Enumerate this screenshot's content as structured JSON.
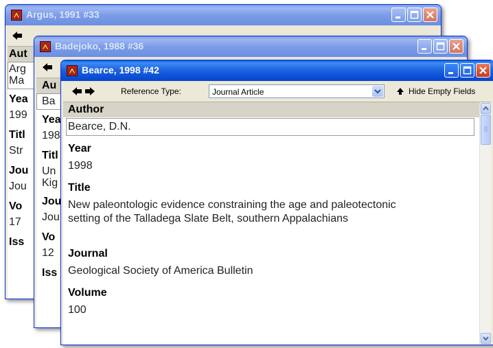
{
  "icons": {
    "app": "endnote-app-icon",
    "minimize": "minimize-icon",
    "maximize": "maximize-icon",
    "close": "close-icon",
    "back": "back-arrow-icon",
    "forward": "forward-arrow-icon",
    "collapse": "collapse-up-icon",
    "dropdown": "chevron-down-icon"
  },
  "colors": {
    "titlebar_active": "#0a5fe0",
    "titlebar_inactive": "#7c9ce8",
    "close": "#c53b1b",
    "selected_field": "#d6d3c7"
  },
  "window1": {
    "title": "Argus, 1991 #33",
    "fields": [
      {
        "label": "Aut",
        "value_lines": [
          "Arg",
          "Ma"
        ]
      },
      {
        "label": "Yea",
        "value": "199"
      },
      {
        "label": "Titl",
        "value": "Str"
      },
      {
        "label": "Jou",
        "value": "Jou"
      },
      {
        "label": "Vo",
        "value": "17"
      },
      {
        "label": "Iss"
      }
    ]
  },
  "window2": {
    "title": "Badejoko, 1988 #36",
    "fields": [
      {
        "label": "Au",
        "value": "Ba"
      },
      {
        "label": "Yea",
        "value": "198"
      },
      {
        "label": "Titl",
        "value_lines": [
          "Un",
          "Kig"
        ]
      },
      {
        "label": "Jou",
        "value": "Jou"
      },
      {
        "label": "Vo",
        "value": "12"
      },
      {
        "label": "Iss"
      }
    ]
  },
  "window3": {
    "title": "Bearce, 1998 #42",
    "toolbar": {
      "reference_type_label": "Reference Type:",
      "reference_type_value": "Journal Article",
      "hide_empty_label": "Hide Empty Fields"
    },
    "fields": {
      "author": {
        "label": "Author",
        "value": "Bearce, D.N."
      },
      "year": {
        "label": "Year",
        "value": "1998"
      },
      "title": {
        "label": "Title",
        "value": "New paleontologic evidence constraining the age and paleotectonic setting of the Talladega Slate Belt, southern Appalachians"
      },
      "journal": {
        "label": "Journal",
        "value": "Geological Society of America Bulletin"
      },
      "volume": {
        "label": "Volume",
        "value": "100"
      }
    }
  }
}
